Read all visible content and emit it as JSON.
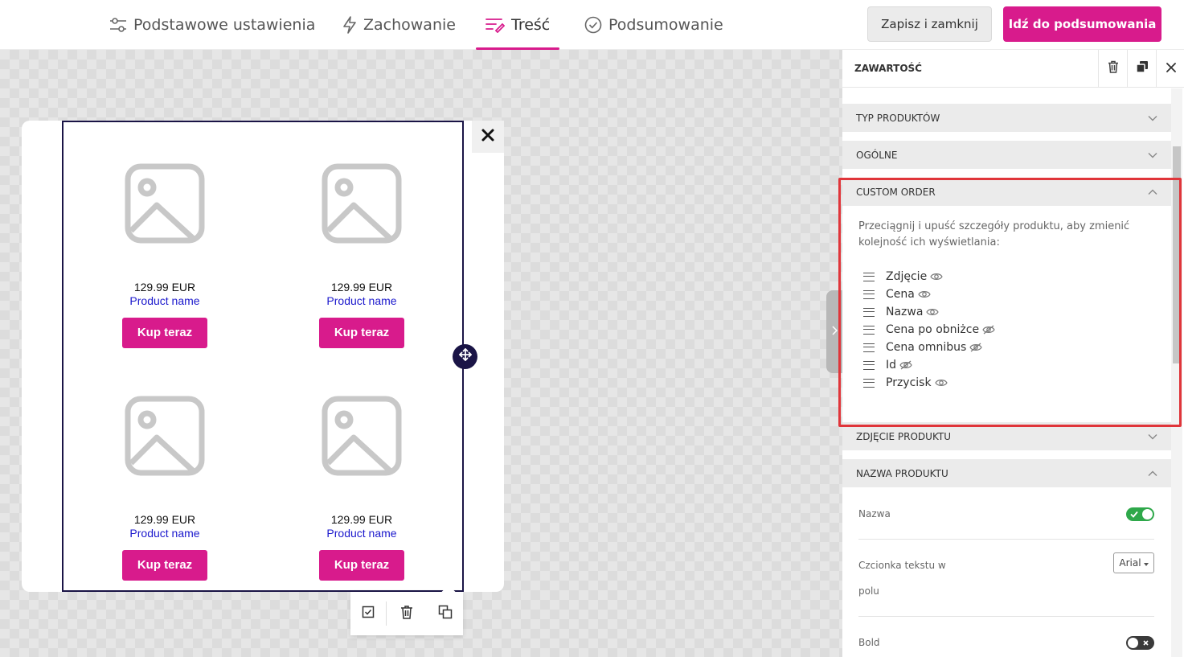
{
  "tabs": [
    {
      "label": "Podstawowe ustawienia",
      "icon": "sliders-icon"
    },
    {
      "label": "Zachowanie",
      "icon": "lightning-icon"
    },
    {
      "label": "Treść",
      "icon": "content-icon",
      "active": true
    },
    {
      "label": "Podsumowanie",
      "icon": "check-circle-icon"
    }
  ],
  "header_buttons": {
    "save_close": "Zapisz i zamknij",
    "go_summary": "Idź do podsumowania"
  },
  "colors": {
    "accent": "#d81b8c",
    "dark_navy": "#1a1446",
    "link_blue": "#1a17cc",
    "highlight_red": "#e0353a",
    "toggle_on": "#2ea84a"
  },
  "products": [
    {
      "price": "129.99 EUR",
      "name": "Product name",
      "button": "Kup teraz"
    },
    {
      "price": "129.99 EUR",
      "name": "Product name",
      "button": "Kup teraz"
    },
    {
      "price": "129.99 EUR",
      "name": "Product name",
      "button": "Kup teraz"
    },
    {
      "price": "129.99 EUR",
      "name": "Product name",
      "button": "Kup teraz"
    }
  ],
  "panel": {
    "title": "ZAWARTOŚĆ",
    "sections": {
      "product_type": "TYP PRODUKTÓW",
      "general": "OGÓLNE",
      "custom_order": "CUSTOM ORDER",
      "product_image": "ZDJĘCIE PRODUKTU",
      "product_name": "NAZWA PRODUKTU"
    },
    "custom_order_help": "Przeciągnij i upuść szczegóły produktu, aby zmienić kolejność ich wyświetlania:",
    "order_items": [
      {
        "label": "Zdjęcie",
        "visible": true
      },
      {
        "label": "Cena",
        "visible": true
      },
      {
        "label": "Nazwa",
        "visible": true
      },
      {
        "label": "Cena po obniżce",
        "visible": false
      },
      {
        "label": "Cena omnibus",
        "visible": false
      },
      {
        "label": "Id",
        "visible": false
      },
      {
        "label": "Przycisk",
        "visible": true
      }
    ],
    "name_settings": {
      "name_label": "Nazwa",
      "name_toggle": true,
      "font_label_line1": "Czcionka tekstu w",
      "font_label_line2": "polu",
      "font_value": "Arial",
      "bold_label": "Bold",
      "bold_toggle": false
    }
  }
}
